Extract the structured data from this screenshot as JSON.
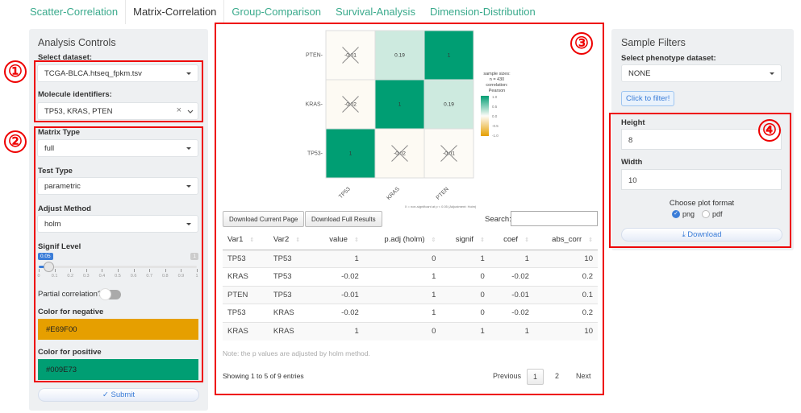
{
  "tabs": [
    {
      "label": "Scatter-Correlation",
      "active": false
    },
    {
      "label": "Matrix-Correlation",
      "active": true
    },
    {
      "label": "Group-Comparison",
      "active": false
    },
    {
      "label": "Survival-Analysis",
      "active": false
    },
    {
      "label": "Dimension-Distribution",
      "active": false
    }
  ],
  "annotations": [
    "①",
    "②",
    "③",
    "④"
  ],
  "left_panel": {
    "title": "Analysis Controls",
    "dataset_label": "Select dataset:",
    "dataset_value": "TCGA-BLCA.htseq_fpkm.tsv",
    "molecule_label": "Molecule identifiers:",
    "molecule_value": "TP53, KRAS, PTEN",
    "clear_symbol": "×",
    "matrix_type_label": "Matrix Type",
    "matrix_type_value": "full",
    "test_type_label": "Test Type",
    "test_type_value": "parametric",
    "adjust_method_label": "Adjust Method",
    "adjust_method_value": "holm",
    "signif_label": "Signif Level",
    "signif_value": "0.05",
    "signif_max": "1",
    "slider_ticks": [
      "0",
      "0.1",
      "0.2",
      "0.3",
      "0.4",
      "0.5",
      "0.6",
      "0.7",
      "0.8",
      "0.9",
      "1"
    ],
    "partial_label": "Partial correlation?",
    "partial_on": false,
    "neg_color_label": "Color for negative",
    "neg_color": "#E69F00",
    "pos_color_label": "Color for positive",
    "pos_color": "#009E73",
    "submit_label": "✓ Submit"
  },
  "chart_data": {
    "type": "heatmap",
    "title": "",
    "x_categories": [
      "TP53",
      "KRAS",
      "PTEN"
    ],
    "y_categories": [
      "PTEN",
      "KRAS",
      "TP53"
    ],
    "cells": [
      {
        "x": "TP53",
        "y": "PTEN",
        "value": -0.01,
        "label": "-0.01",
        "nonsig": true
      },
      {
        "x": "KRAS",
        "y": "PTEN",
        "value": 0.19,
        "label": "0.19",
        "nonsig": false
      },
      {
        "x": "PTEN",
        "y": "PTEN",
        "value": 1,
        "label": "1",
        "nonsig": false
      },
      {
        "x": "TP53",
        "y": "KRAS",
        "value": -0.02,
        "label": "-0.02",
        "nonsig": true
      },
      {
        "x": "KRAS",
        "y": "KRAS",
        "value": 1,
        "label": "1",
        "nonsig": false
      },
      {
        "x": "PTEN",
        "y": "KRAS",
        "value": 0.19,
        "label": "0.19",
        "nonsig": false
      },
      {
        "x": "TP53",
        "y": "TP53",
        "value": 1,
        "label": "1",
        "nonsig": false
      },
      {
        "x": "KRAS",
        "y": "TP53",
        "value": -0.02,
        "label": "-0.02",
        "nonsig": true
      },
      {
        "x": "PTEN",
        "y": "TP53",
        "value": -0.01,
        "label": "-0.01",
        "nonsig": true
      }
    ],
    "legend": {
      "title_lines": [
        "sample sizes:",
        "n = 430",
        "correlation:",
        "Pearson"
      ],
      "ticks": [
        "1.0",
        "0.5",
        "0.0",
        "-0.5",
        "-1.0"
      ],
      "range": [
        -1,
        1
      ],
      "low_color": "#E69F00",
      "mid_color": "#FFFFFF",
      "high_color": "#009E73",
      "placement": "right"
    },
    "caption": "X = non-significant at p < 0.05 (Adjustment: Holm)"
  },
  "table": {
    "download_current_label": "Download Current Page",
    "download_full_label": "Download Full Results",
    "search_label": "Search:",
    "search_value": "",
    "columns": [
      "Var1",
      "Var2",
      "value",
      "p.adj (holm)",
      "signif",
      "coef",
      "abs_corr"
    ],
    "rows": [
      [
        "TP53",
        "TP53",
        "1",
        "0",
        "1",
        "1",
        "10"
      ],
      [
        "KRAS",
        "TP53",
        "-0.02",
        "1",
        "0",
        "-0.02",
        "0.2"
      ],
      [
        "PTEN",
        "TP53",
        "-0.01",
        "1",
        "0",
        "-0.01",
        "0.1"
      ],
      [
        "TP53",
        "KRAS",
        "-0.02",
        "1",
        "0",
        "-0.02",
        "0.2"
      ],
      [
        "KRAS",
        "KRAS",
        "1",
        "0",
        "1",
        "1",
        "10"
      ]
    ],
    "note": "Note: the p values are adjusted by holm method.",
    "info": "Showing 1 to 5 of 9 entries",
    "pagination": {
      "previous": "Previous",
      "pages": [
        "1",
        "2"
      ],
      "current": "1",
      "next": "Next"
    }
  },
  "right_panel": {
    "title": "Sample Filters",
    "phenotype_label": "Select phenotype dataset:",
    "phenotype_value": "NONE",
    "filter_button": "Click to filter!",
    "height_label": "Height",
    "height_value": "8",
    "width_label": "Width",
    "width_value": "10",
    "format_label": "Choose plot format",
    "format_options": [
      "png",
      "pdf"
    ],
    "format_selected": "png",
    "download_label": "Download"
  }
}
